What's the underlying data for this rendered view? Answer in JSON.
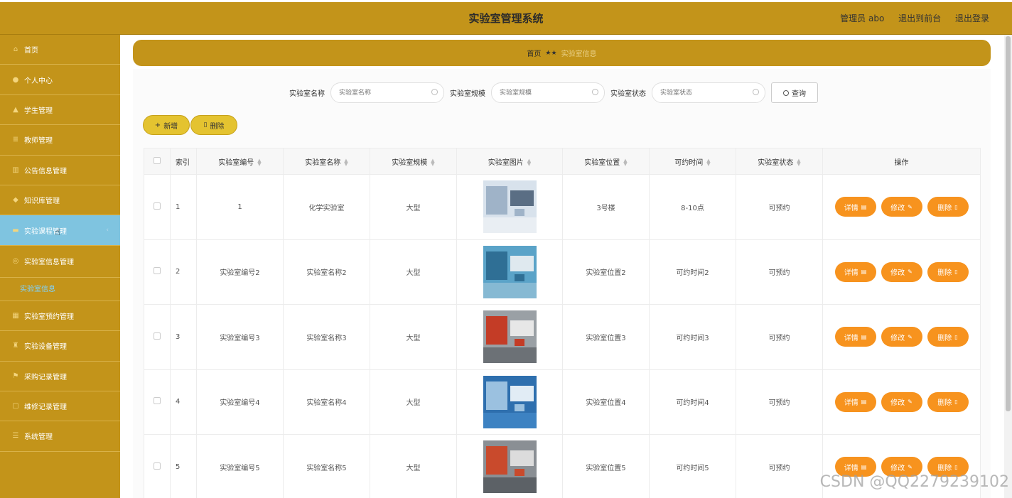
{
  "app": {
    "title": "实验室管理系统",
    "admin_label": "管理员 abo",
    "to_front_label": "退出到前台",
    "logout_label": "退出登录"
  },
  "sidebar": {
    "items": [
      {
        "label": "首页",
        "icon": "home-icon"
      },
      {
        "label": "个人中心",
        "icon": "user-icon"
      },
      {
        "label": "学生管理",
        "icon": "graduation-icon"
      },
      {
        "label": "教师管理",
        "icon": "list-icon"
      },
      {
        "label": "公告信息管理",
        "icon": "bank-icon"
      },
      {
        "label": "知识库管理",
        "icon": "tag-icon"
      },
      {
        "label": "实验课程管理",
        "icon": "briefcase-icon",
        "active": true
      },
      {
        "label": "实验室信息管理",
        "icon": "globe-icon"
      },
      {
        "label": "实验室预约管理",
        "icon": "calendar-icon"
      },
      {
        "label": "实验设备管理",
        "icon": "trophy-icon"
      },
      {
        "label": "采购记录管理",
        "icon": "flag-icon"
      },
      {
        "label": "维修记录管理",
        "icon": "window-icon"
      },
      {
        "label": "系统管理",
        "icon": "menu-icon"
      }
    ],
    "submenu_label": "实验室信息"
  },
  "breadcrumb": {
    "home": "首页",
    "separator": "★★",
    "current": "实验室信息"
  },
  "search": {
    "name_label": "实验室名称",
    "name_placeholder": "实验室名称",
    "scale_label": "实验室规模",
    "scale_placeholder": "实验室规模",
    "status_label": "实验室状态",
    "status_placeholder": "实验室状态",
    "query_label": "查询"
  },
  "toolbar": {
    "add_label": "新增",
    "delete_label": "删除"
  },
  "table": {
    "headers": [
      "索引",
      "实验室编号",
      "实验室名称",
      "实验室规模",
      "实验室图片",
      "实验室位置",
      "可约时间",
      "实验室状态",
      "操作"
    ],
    "rows": [
      {
        "index": "1",
        "code": "1",
        "name": "化学实验室",
        "scale": "大型",
        "location": "3号楼",
        "time": "8-10点",
        "status": "可预约"
      },
      {
        "index": "2",
        "code": "实验室编号2",
        "name": "实验室名称2",
        "scale": "大型",
        "location": "实验室位置2",
        "time": "可约时间2",
        "status": "可预约"
      },
      {
        "index": "3",
        "code": "实验室编号3",
        "name": "实验室名称3",
        "scale": "大型",
        "location": "实验室位置3",
        "time": "可约时间3",
        "status": "可预约"
      },
      {
        "index": "4",
        "code": "实验室编号4",
        "name": "实验室名称4",
        "scale": "大型",
        "location": "实验室位置4",
        "time": "可约时间4",
        "status": "可预约"
      },
      {
        "index": "5",
        "code": "实验室编号5",
        "name": "实验室名称5",
        "scale": "大型",
        "location": "实验室位置5",
        "time": "可约时间5",
        "status": "可预约"
      }
    ],
    "actions": {
      "detail": "详情",
      "edit": "修改",
      "delete": "删除"
    }
  },
  "watermark": "CSDN @QQ2279239102",
  "colors": {
    "brand": "#c3941a",
    "active_menu": "#7fc4e0",
    "action_button": "#f7931e",
    "toolbar_button": "#e4c330"
  }
}
